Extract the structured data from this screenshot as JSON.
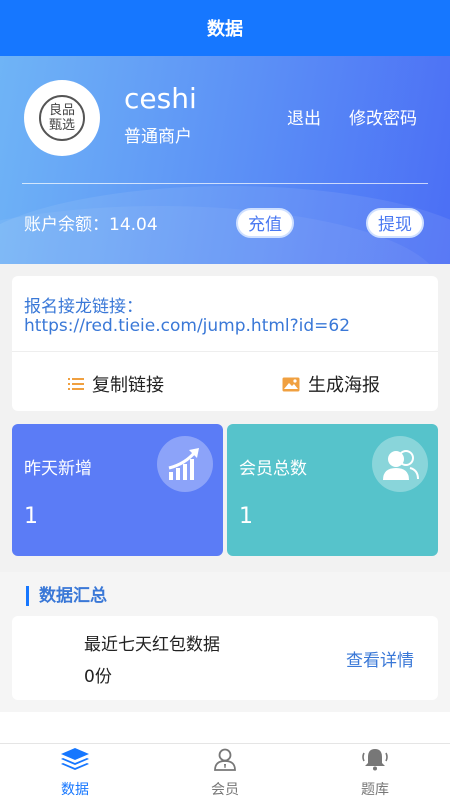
{
  "header": {
    "title": "数据"
  },
  "profile": {
    "username": "ceshi",
    "role": "普通商户",
    "logout_label": "退出",
    "change_password_label": "修改密码",
    "avatar_seal_text": [
      "良",
      "品",
      "甄",
      "选"
    ],
    "balance_label": "账户余额：",
    "balance_value": "14.04",
    "recharge_label": "充值",
    "withdraw_label": "提现"
  },
  "signup_link": {
    "label": "报名接龙链接：",
    "url": "https://red.tieie.com/jump.html?id=62",
    "copy_label": "复制链接",
    "poster_label": "生成海报"
  },
  "stats": [
    {
      "title": "昨天新增",
      "value": "1",
      "icon": "growth-chart-icon",
      "color": "#5b7cf6"
    },
    {
      "title": "会员总数",
      "value": "1",
      "icon": "members-icon",
      "color": "#56c3cb"
    }
  ],
  "summary": {
    "section_title": "数据汇总",
    "card_title": "最近七天红包数据",
    "card_value": "0份",
    "detail_label": "查看详情"
  },
  "tabs": [
    {
      "label": "数据",
      "icon": "layers-icon",
      "active": true
    },
    {
      "label": "会员",
      "icon": "user-icon",
      "active": false
    },
    {
      "label": "题库",
      "icon": "bell-icon",
      "active": false
    }
  ],
  "colors": {
    "primary": "#1677ff",
    "link": "#3a78d7"
  }
}
